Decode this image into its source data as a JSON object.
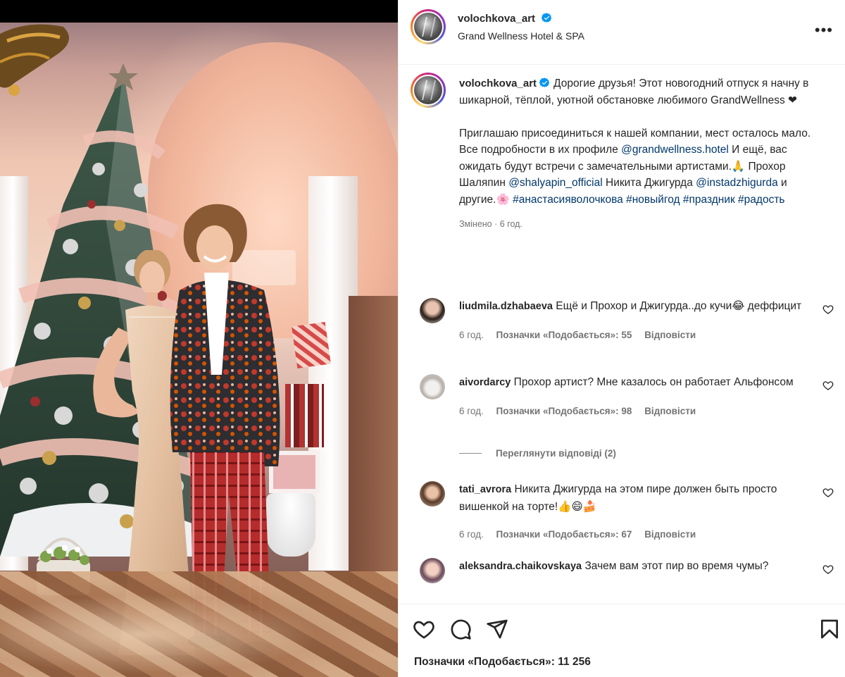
{
  "post": {
    "username": "volochkova_art",
    "location": "Grand Wellness Hotel & SPA",
    "verified": true
  },
  "caption": {
    "username": "volochkova_art",
    "p1": "Дорогие друзья! Этот новогодний отпуск я начну в шикарной, тёплой, уютной обстановке любимого GrandWellness ❤",
    "p2_a": "Приглашаю присоединиться к нашей компании, мест осталось мало. Все подробности в их профиле ",
    "mention_hotel": "@grandwellness.hotel",
    "p2_b": " И ещё, вас ожидать будут встречи с замечательными артистами.🙏 Прохор Шаляпин ",
    "mention_shalyapin": "@shalyapin_official",
    "p2_c": " Никита Джигурда ",
    "mention_dzhigurda": "@instadzhigurda",
    "p2_d": " и другие.🌸 ",
    "hashtags": "#анастасияволочкова #новыйгод #праздник #радость",
    "edited": "Змінено · 6 год."
  },
  "comments": [
    {
      "username": "liudmila.dzhabaeva",
      "text": "Ещё и Прохор и Джигурда..до кучи😂 деффицит",
      "time": "6 год.",
      "likes": "Позначки «Подобається»: 55",
      "reply": "Відповісти"
    },
    {
      "username": "aivordarcy",
      "text": "Прохор артист? Мне казалось он работает Альфонсом",
      "time": "6 год.",
      "likes": "Позначки «Подобається»: 98",
      "reply": "Відповісти"
    },
    {
      "username": "tati_avrora",
      "text": "Никита Джигурда на этом пире должен быть просто вишенкой на торте!👍😄🍰",
      "time": "6 год.",
      "likes": "Позначки «Подобається»: 67",
      "reply": "Відповісти"
    },
    {
      "username": "aleksandra.chaikovskaya",
      "text": "Зачем вам этот пир во время чумы?"
    }
  ],
  "view_replies": "Переглянути відповіді (2)",
  "actions": {
    "like_icon": "heart-icon",
    "comment_icon": "comment-icon",
    "share_icon": "share-icon",
    "save_icon": "bookmark-icon"
  },
  "likes_total": "Позначки «Подобається»: 11 256",
  "colors": {
    "link": "#00376b",
    "verified": "#0095f6",
    "meta": "#737373"
  }
}
